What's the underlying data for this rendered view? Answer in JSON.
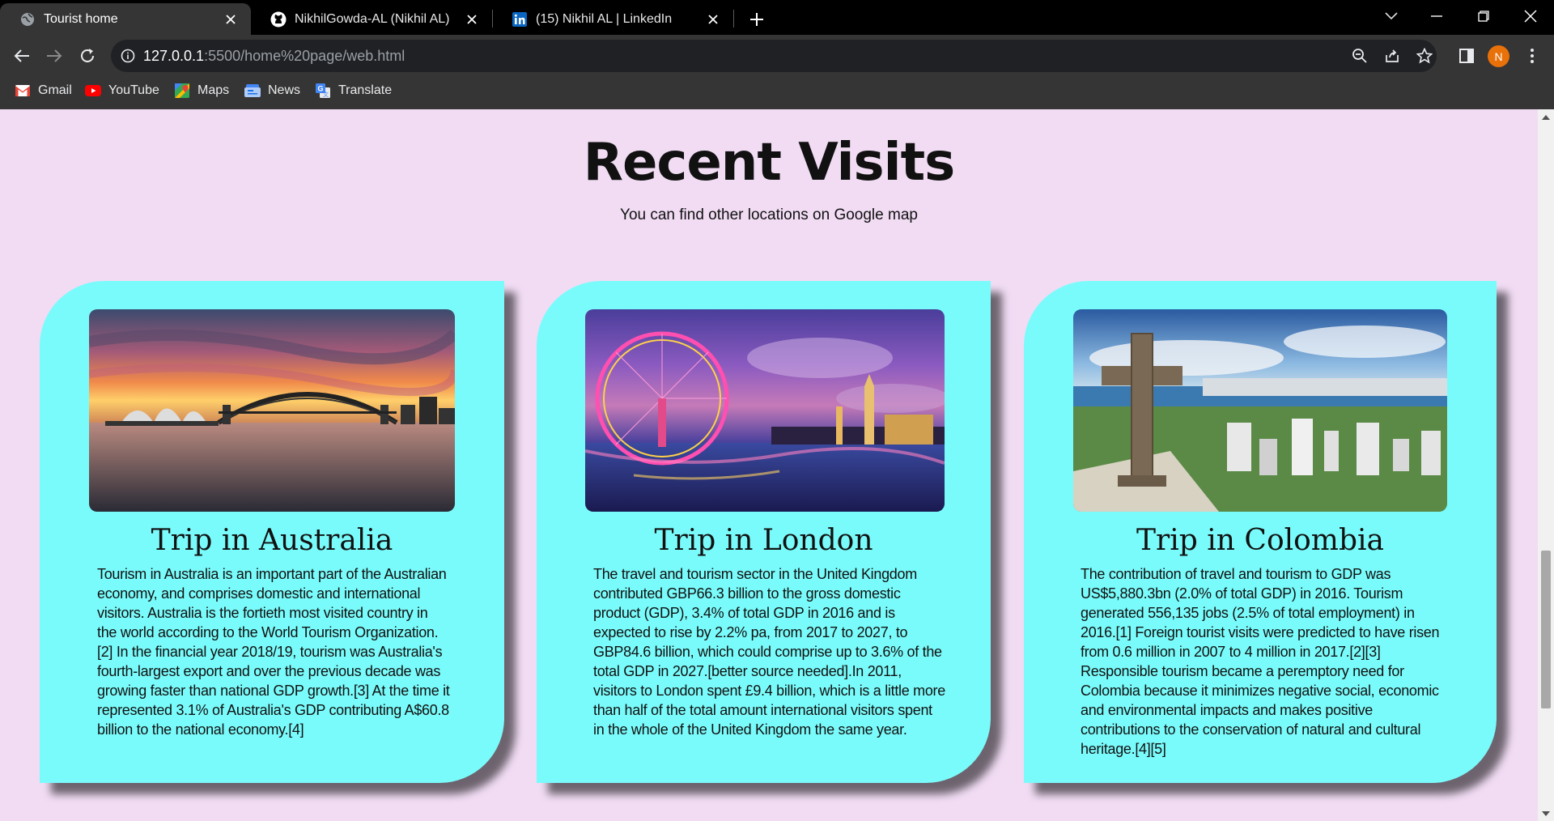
{
  "browser": {
    "tabs": [
      {
        "title": "Tourist home",
        "icon": "globe-icon",
        "active": true
      },
      {
        "title": "NikhilGowda-AL (Nikhil AL)",
        "icon": "github-icon",
        "active": false
      },
      {
        "title": "(15) Nikhil AL | LinkedIn",
        "icon": "linkedin-icon",
        "active": false
      }
    ],
    "url": {
      "host": "127.0.0.1",
      "path": ":5500/home%20page/web.html"
    },
    "profile_initial": "N",
    "bookmarks": [
      {
        "label": "Gmail",
        "icon": "gmail-icon"
      },
      {
        "label": "YouTube",
        "icon": "youtube-icon"
      },
      {
        "label": "Maps",
        "icon": "maps-icon"
      },
      {
        "label": "News",
        "icon": "news-icon"
      },
      {
        "label": "Translate",
        "icon": "translate-icon"
      }
    ]
  },
  "page": {
    "title": "Recent Visits",
    "subtitle": "You can find other locations on Google map",
    "cards": [
      {
        "title": "Trip in Australia",
        "image": "sydney-opera-house-harbour-bridge-sunset",
        "text": "Tourism in Australia is an important part of the Australian economy, and comprises domestic and international visitors. Australia is the fortieth most visited country in the world according to the World Tourism Organization.[2] In the financial year 2018/19, tourism was Australia's fourth-largest export and over the previous decade was growing faster than national GDP growth.[3] At the time it represented 3.1% of Australia's GDP contributing A$60.8 billion to the national economy.[4]"
      },
      {
        "title": "Trip in London",
        "image": "london-eye-thames-night",
        "text": "The travel and tourism sector in the United Kingdom contributed GBP66.3 billion to the gross domestic product (GDP), 3.4% of total GDP in 2016 and is expected to rise by 2.2% pa, from 2017 to 2027, to GBP84.6 billion, which could comprise up to 3.6% of the total GDP in 2027.[better source needed].In 2011, visitors to London spent £9.4 billion, which is a little more than half of the total amount international visitors spent in the whole of the United Kingdom the same year."
      },
      {
        "title": "Trip in Colombia",
        "image": "cartagena-stone-cross-city-view",
        "text": "The contribution of travel and tourism to GDP was US$5,880.3bn (2.0% of total GDP) in 2016. Tourism generated 556,135 jobs (2.5% of total employment) in 2016.[1] Foreign tourist visits were predicted to have risen from 0.6 million in 2007 to 4 million in 2017.[2][3] Responsible tourism became a peremptory need for Colombia because it minimizes negative social, economic and environmental impacts and makes positive contributions to the conservation of natural and cultural heritage.[4][5]"
      }
    ]
  },
  "colors": {
    "page_background": "#f1dcf4",
    "card_background": "#7afbfb",
    "chrome_dark": "#353535"
  }
}
